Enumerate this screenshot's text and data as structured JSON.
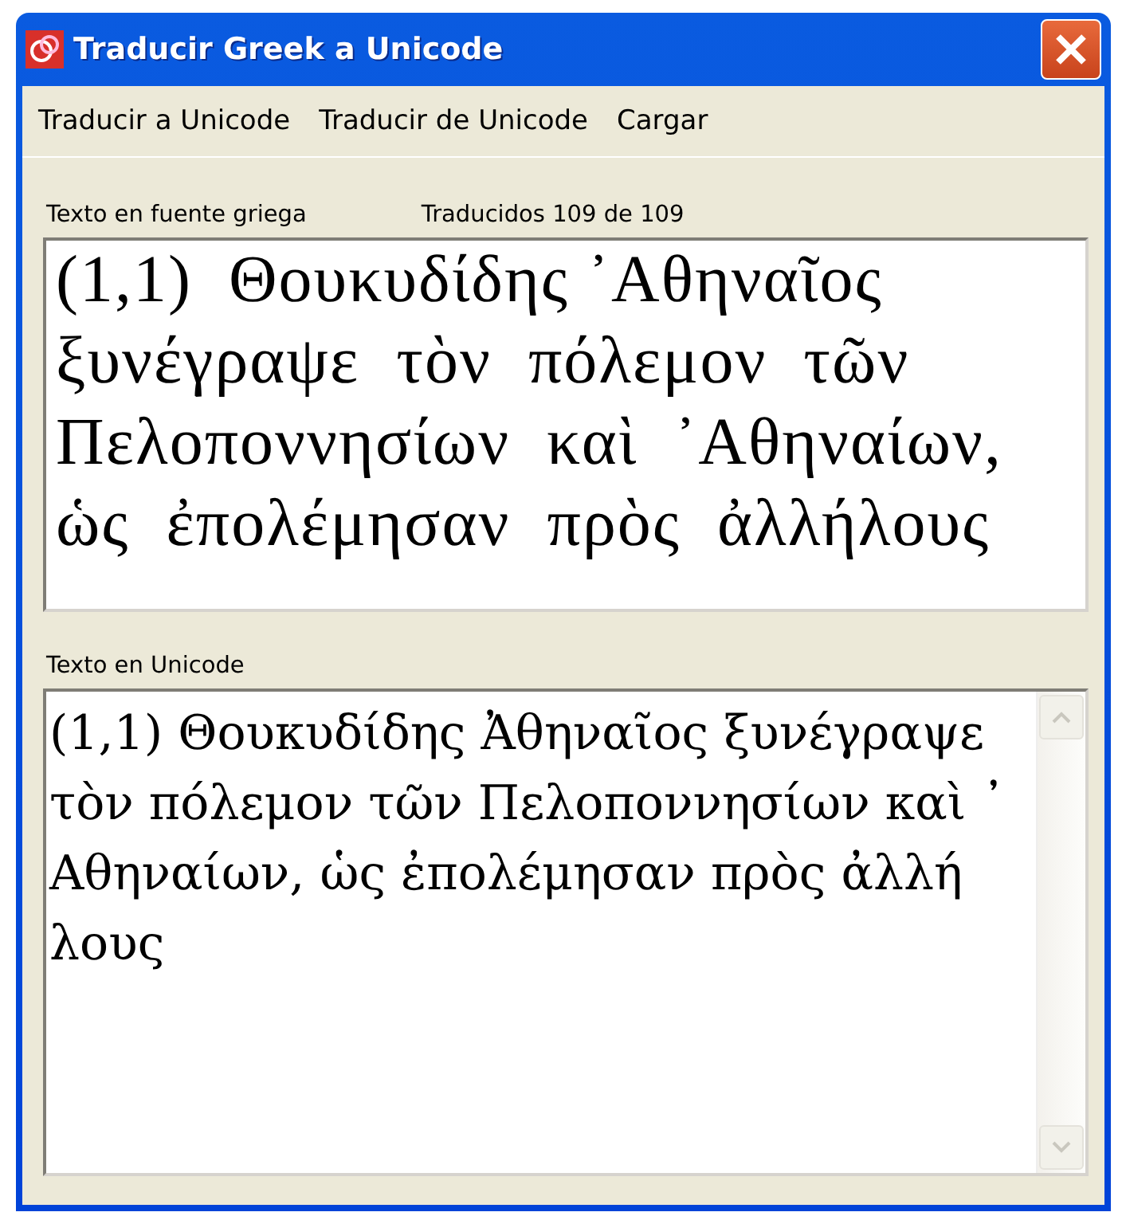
{
  "window": {
    "title": "Traducir Greek a Unicode"
  },
  "menu": [
    "Traducir a Unicode",
    "Traducir de Unicode",
    "Cargar"
  ],
  "source": {
    "label": "Texto en fuente griega",
    "status": "Traducidos 109 de 109",
    "lines": [
      "(1,1)  Θουκυδίδης ᾿Αθηναῖος",
      "ξυνέγραψε  τὸν  πόλεμον  τῶν",
      "Πελοποννησίων  καὶ  ᾿Αθηναίων,",
      "ὡς  ἐπολέμησαν  πρὸς  ἀλλήλους"
    ]
  },
  "unicode": {
    "label": "Texto en Unicode",
    "lines": [
      "(1,1) Θουκυδίδης Ἀθηναῖος ξυνέγραψε",
      "τὸν πόλεμον τῶν Πελοποννησίων καὶ ᾿",
      "Αθηναίων, ὡς ἐπολέμησαν πρὸς ἀλλή",
      "λους"
    ]
  }
}
